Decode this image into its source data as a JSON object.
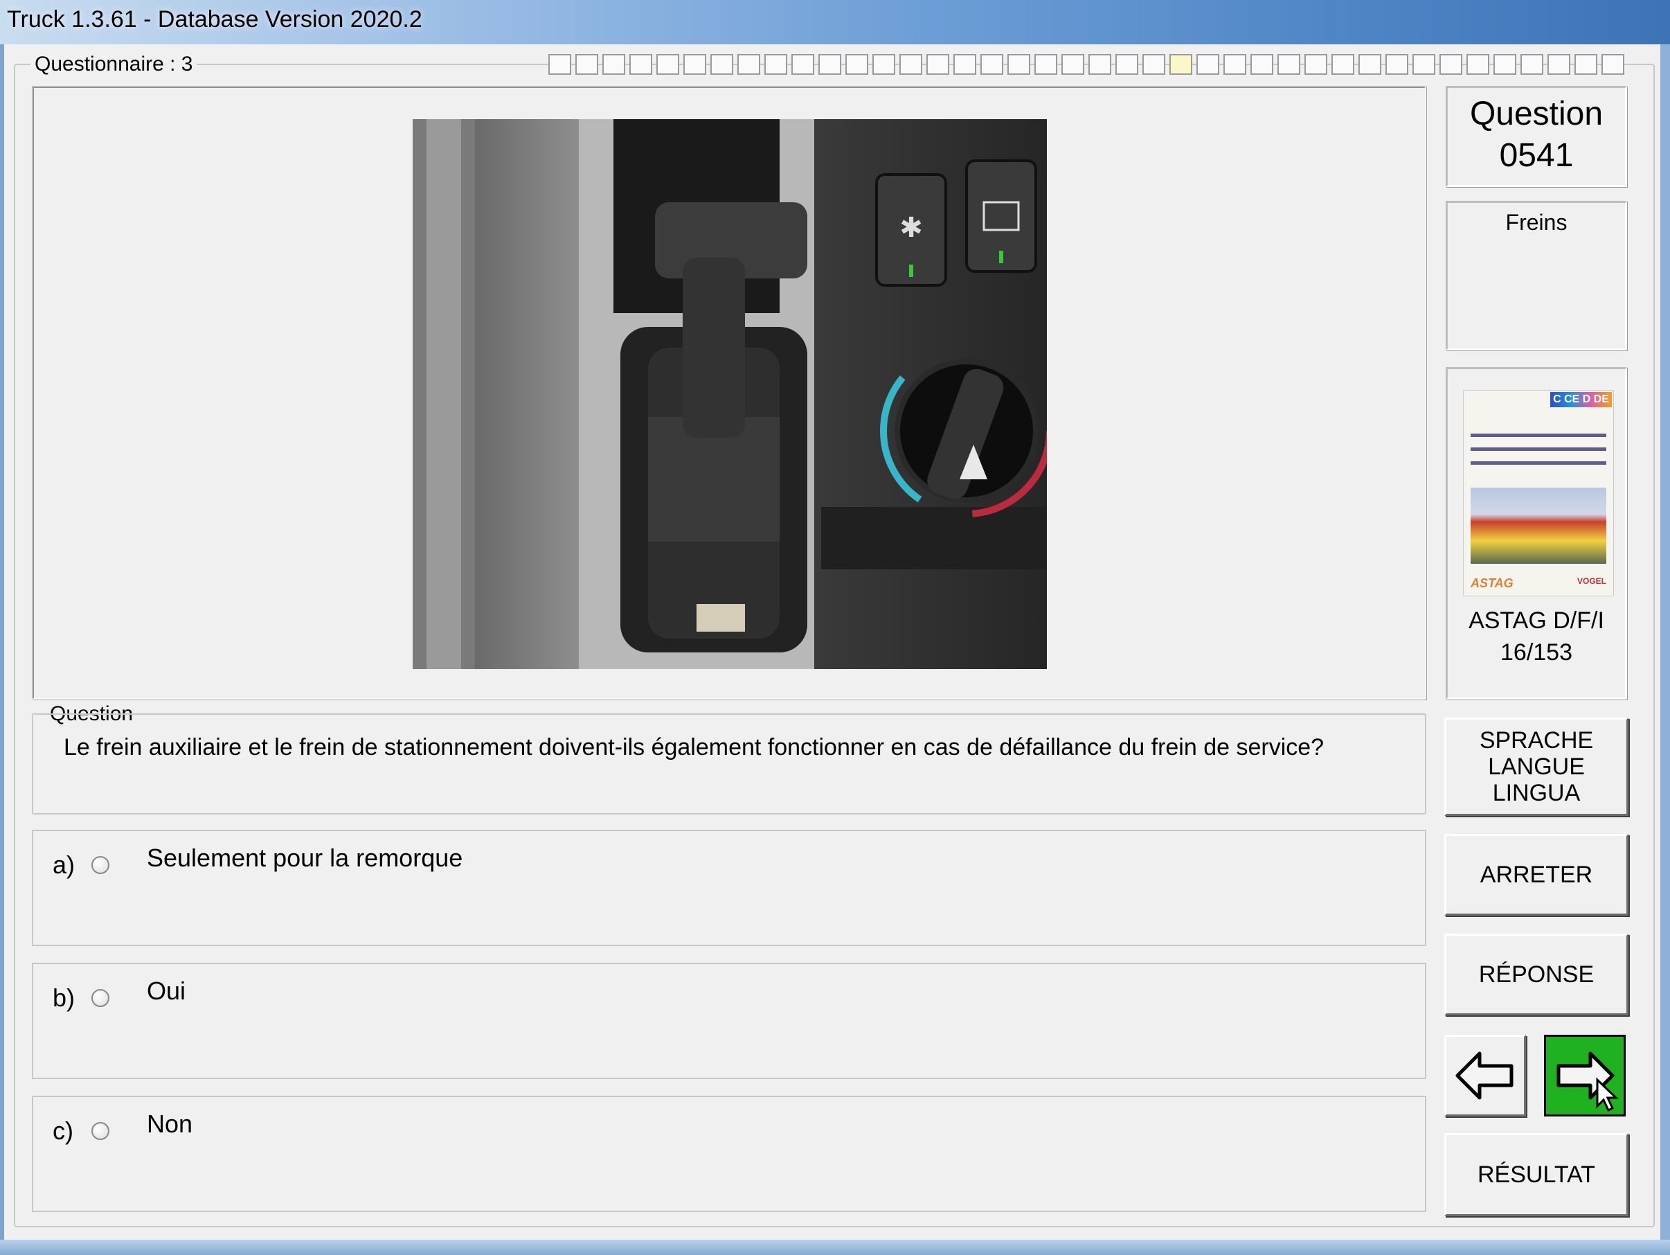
{
  "window": {
    "title": "Truck 1.3.61 - Database Version 2020.2"
  },
  "questionnaire": {
    "label": "Questionnaire : 3",
    "progress_total": 40,
    "progress_current": 24
  },
  "image": {
    "description_icon": "truck-dashboard-photo"
  },
  "question": {
    "group_label": "Question",
    "text": "Le frein auxiliaire et le frein de stationnement doivent-ils également fonctionner en cas de défaillance du frein de service?"
  },
  "answers": [
    {
      "letter": "a)",
      "text": "Seulement pour la remorque"
    },
    {
      "letter": "b)",
      "text": "Oui"
    },
    {
      "letter": "c)",
      "text": "Non"
    }
  ],
  "side": {
    "question_label": "Question",
    "question_number": "0541",
    "category": "Freins",
    "book_tag": "C CE D DE",
    "book_publisher_left": "ASTAG",
    "book_publisher_right": "VOGEL",
    "source_line1": "ASTAG D/F/I",
    "source_line2": "16/153"
  },
  "buttons": {
    "language_1": "SPRACHE",
    "language_2": "LANGUE",
    "language_3": "LINGUA",
    "stop": "ARRETER",
    "answer": "RÉPONSE",
    "result": "RÉSULTAT"
  },
  "icons": {
    "prev": "arrow-left-icon",
    "next": "arrow-right-icon"
  },
  "colors": {
    "next_button": "#1fb11f",
    "title_gradient_end": "#3e74b6"
  }
}
